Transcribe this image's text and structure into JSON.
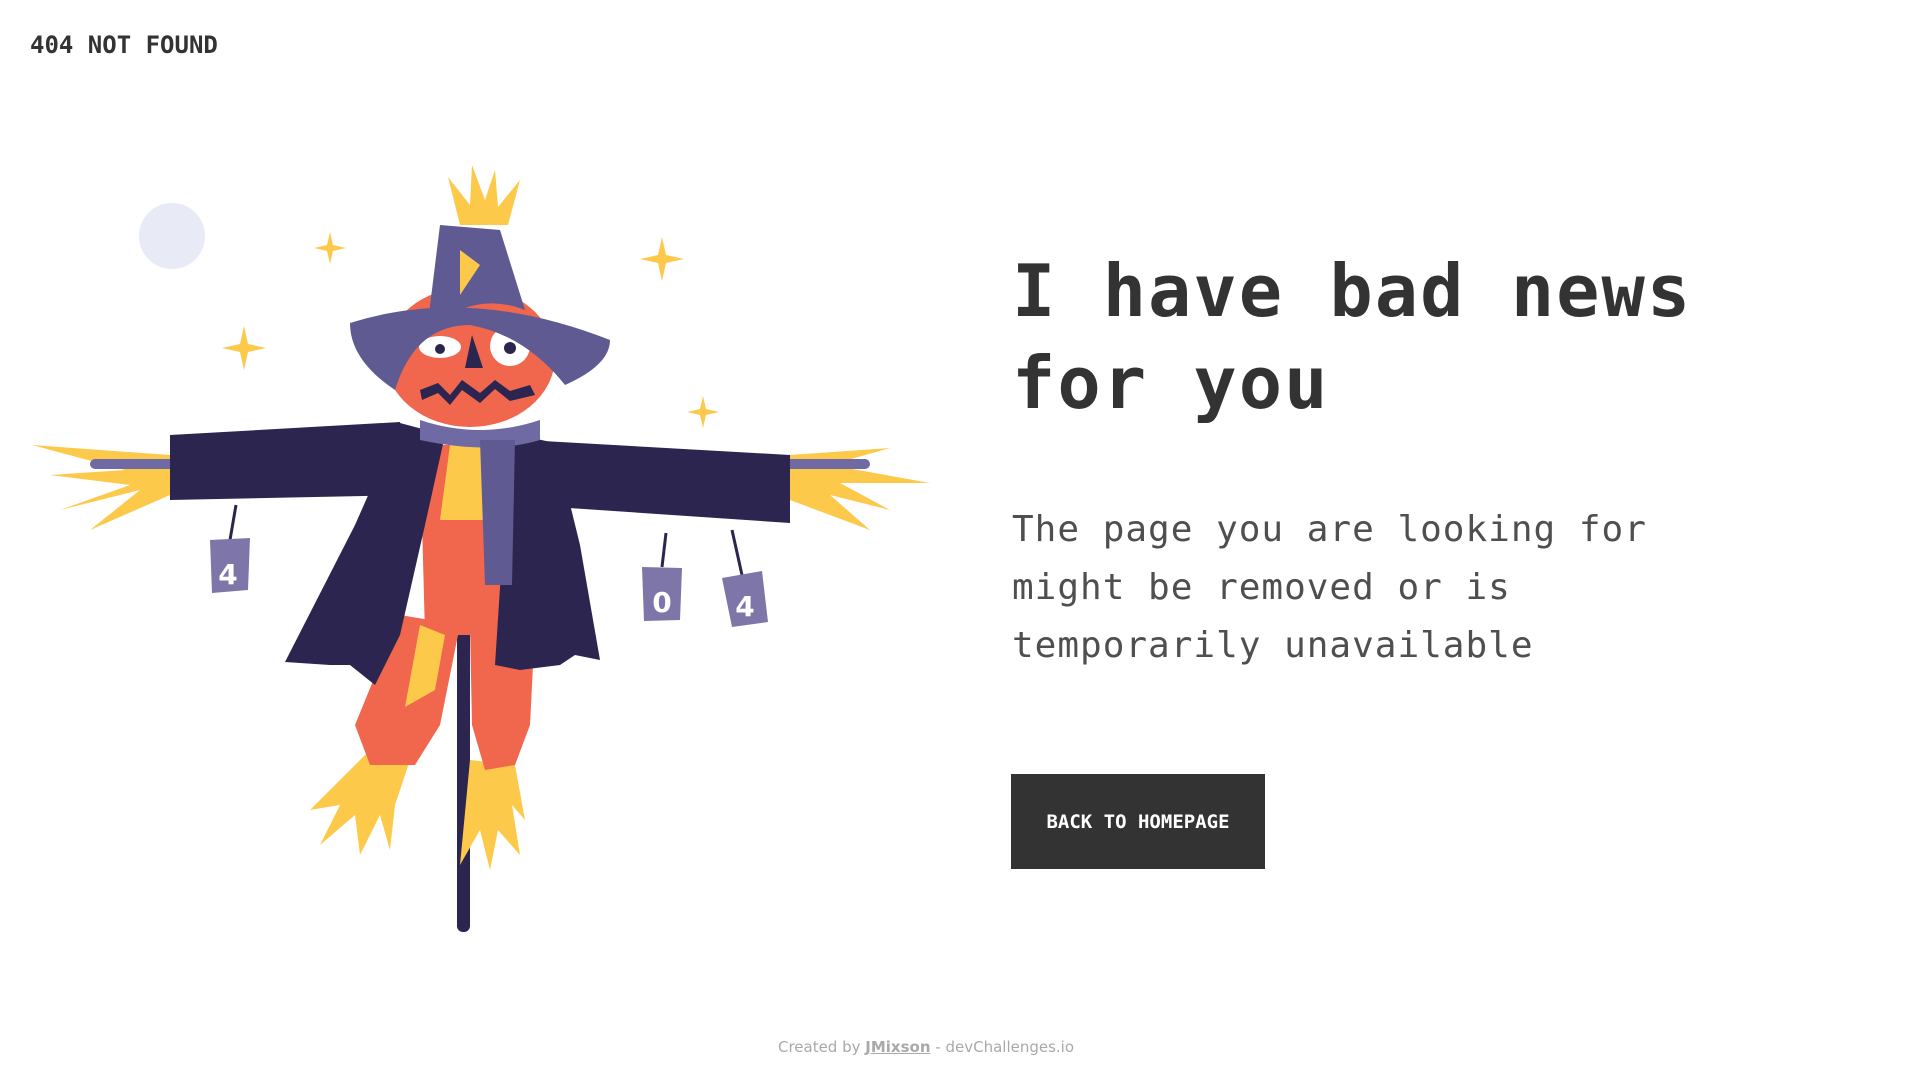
{
  "header": {
    "logo_text": "404 NOT FOUND"
  },
  "main": {
    "headline_line1": "I have bad news",
    "headline_line2": "for you",
    "description_line1": "The page you are looking for",
    "description_line2": "might be removed or is",
    "description_line3": "temporarily unavailable",
    "button_label": "BACK TO HOMEPAGE"
  },
  "illustration": {
    "can_labels": [
      "4",
      "0",
      "4"
    ],
    "colors": {
      "hat": "#5f5a91",
      "coat": "#2b2550",
      "face": "#f0674e",
      "straw": "#fdc94b",
      "scarf": "#6f6aa3",
      "moon": "#e8eaf6"
    }
  },
  "footer": {
    "prefix": "Created by ",
    "author": "JMixson",
    "suffix": " - devChallenges.io"
  }
}
